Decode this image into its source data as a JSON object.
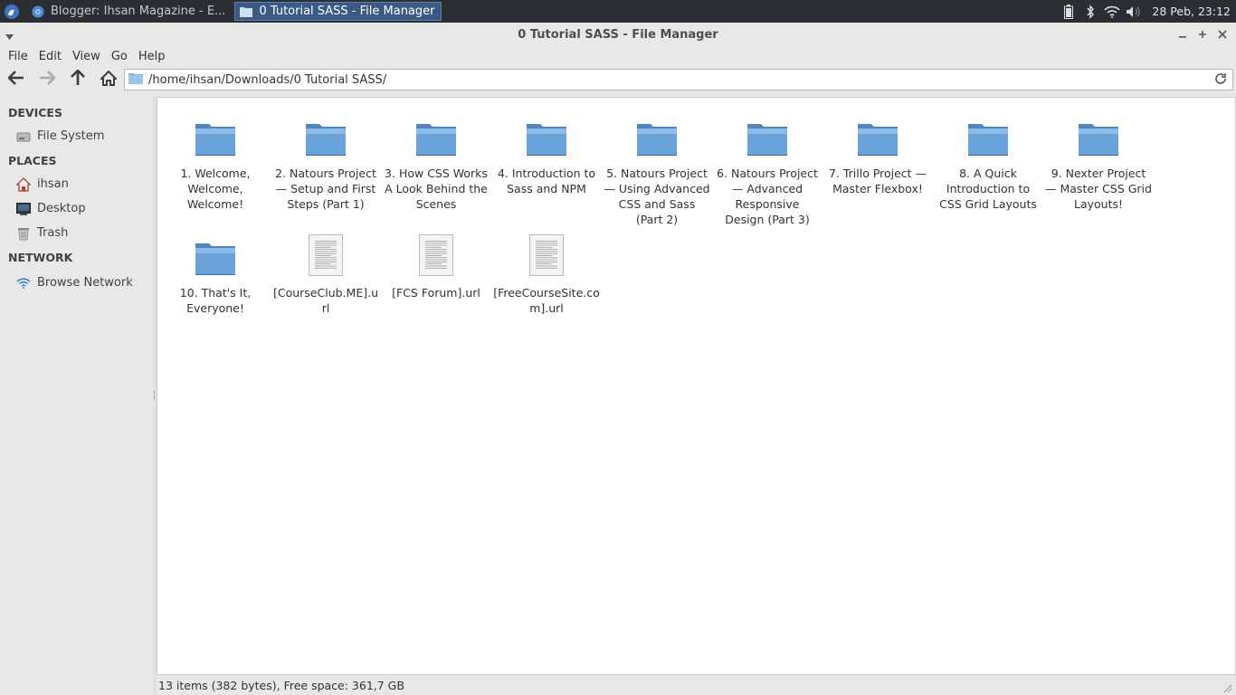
{
  "panel": {
    "tasks": [
      {
        "label": "Blogger: Ihsan Magazine - E...",
        "icon": "chrome-icon",
        "active": false
      },
      {
        "label": "0 Tutorial SASS - File Manager",
        "icon": "folder-icon",
        "active": true
      }
    ],
    "clock": "28 Peb, 23:12"
  },
  "window": {
    "title": "0 Tutorial SASS - File Manager"
  },
  "menu": [
    "File",
    "Edit",
    "View",
    "Go",
    "Help"
  ],
  "location": {
    "path": "/home/ihsan/Downloads/0 Tutorial SASS/"
  },
  "sidebar": {
    "devices_heading": "DEVICES",
    "devices": [
      {
        "label": "File System",
        "icon": "drive-icon"
      }
    ],
    "places_heading": "PLACES",
    "places": [
      {
        "label": "ihsan",
        "icon": "home-icon"
      },
      {
        "label": "Desktop",
        "icon": "desktop-icon"
      },
      {
        "label": "Trash",
        "icon": "trash-icon"
      }
    ],
    "network_heading": "NETWORK",
    "network": [
      {
        "label": "Browse Network",
        "icon": "wifi-icon"
      }
    ]
  },
  "files": [
    {
      "label": "1. Welcome, Welcome, Welcome!",
      "type": "folder"
    },
    {
      "label": "2. Natours Project — Setup and First Steps (Part 1)",
      "type": "folder"
    },
    {
      "label": "3. How CSS Works A Look Behind the Scenes",
      "type": "folder"
    },
    {
      "label": "4. Introduction to Sass and NPM",
      "type": "folder"
    },
    {
      "label": "5. Natours Project — Using Advanced CSS and Sass (Part 2)",
      "type": "folder"
    },
    {
      "label": "6. Natours Project — Advanced Responsive Design (Part 3)",
      "type": "folder"
    },
    {
      "label": "7. Trillo Project — Master Flexbox!",
      "type": "folder"
    },
    {
      "label": "8. A Quick Introduction to CSS Grid Layouts",
      "type": "folder"
    },
    {
      "label": "9. Nexter Project — Master CSS Grid Layouts!",
      "type": "folder"
    },
    {
      "label": "10. That's It, Everyone!",
      "type": "folder"
    },
    {
      "label": "[CourseClub.ME].url",
      "type": "file"
    },
    {
      "label": "[FCS Forum].url",
      "type": "file"
    },
    {
      "label": "[FreeCourseSite.com].url",
      "type": "file"
    }
  ],
  "status": {
    "text": "13 items (382 bytes), Free space: 361,7 GB"
  },
  "colors": {
    "folder": "#6aa3d9",
    "selection": "#3a5a83"
  }
}
